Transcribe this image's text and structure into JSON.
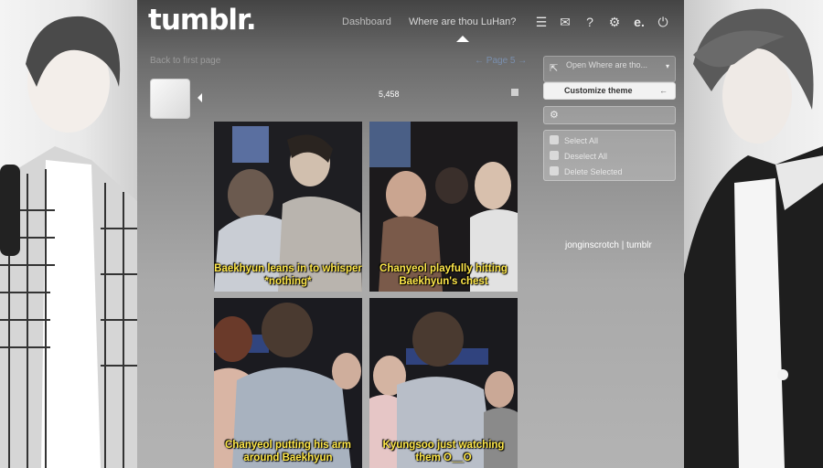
{
  "app": {
    "logo": "tumblr."
  },
  "topnav": {
    "dashboard": "Dashboard",
    "blog": "Where are thou LuHan?"
  },
  "icons": [
    "list-icon",
    "mail-icon",
    "help-icon",
    "gear-icon",
    "edit-icon",
    "power-icon"
  ],
  "breadcrumb": {
    "back": "Back to first page",
    "page": "← Page 5 →"
  },
  "post": {
    "count": "5,458"
  },
  "gifs": [
    {
      "caption": "Baekhyun leans in to whisper *nothing*"
    },
    {
      "caption": "Chanyeol playfully hitting Baekhyun's chest"
    },
    {
      "caption": "Chanyeol putting his arm around Baekhyun"
    },
    {
      "caption": "Kyungsoo just watching them O__O"
    }
  ],
  "sidebar": {
    "open_blog": "Open Where are tho...",
    "open_blog_sub": "",
    "customize": "Customize theme",
    "select_all": "Select All",
    "deselect_all": "Deselect All",
    "delete_selected": "Delete Selected"
  },
  "watermark": "jonginscrotch | tumblr"
}
